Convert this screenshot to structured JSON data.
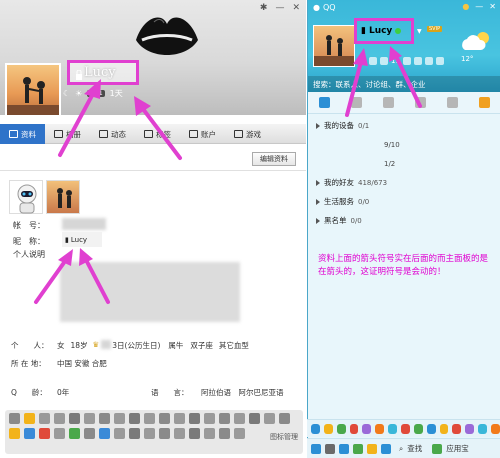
{
  "profile_window": {
    "name": "Lucy",
    "vip_badge": "VIP1",
    "days": "1天",
    "tabs": [
      {
        "label": "资料",
        "icon": "profile-card-icon"
      },
      {
        "label": "相册",
        "icon": "photo-album-icon"
      },
      {
        "label": "动态",
        "icon": "feed-icon"
      },
      {
        "label": "标签",
        "icon": "tag-icon"
      },
      {
        "label": "账户",
        "icon": "account-icon"
      },
      {
        "label": "游戏",
        "icon": "game-icon"
      }
    ],
    "edit_button": "编辑资料",
    "account_label": "帐　号：",
    "nickname_label": "昵　称：",
    "nickname_value": "Lucy",
    "bio_label": "个人说明",
    "person_label": "个　　人：",
    "gender": "女",
    "age": "18岁",
    "birthday": "3日(公历生日)",
    "zodiac": "属牛",
    "constellation": "双子座",
    "blood": "其它血型",
    "location_label": "所 在 地：",
    "location_value": "中国 安徽 合肥",
    "qage_label": "Q　　龄：",
    "qage_value": "0年",
    "language_label": "语　　言：",
    "language_value": "阿拉伯语　阿尔巴尼亚语",
    "icon_manage": "图标管理"
  },
  "qq_panel": {
    "title": "QQ",
    "name": "Lucy",
    "badge": "SVIP",
    "temperature": "12°",
    "count_small": "11",
    "search_placeholder": "搜索：联系人、讨论组、群、企业",
    "groups": [
      {
        "label": "我的设备",
        "count": "0/1"
      },
      {
        "label": "我的好友",
        "count": "418/673"
      },
      {
        "label": "生活服务",
        "count": "0/0"
      },
      {
        "label": "黑名单",
        "count": "0/0"
      }
    ],
    "sub_counts": [
      "9/10",
      "1/2"
    ],
    "annotation": "资料上面的箭头符号实在后面的而主面板的是在箭头的，这证明符号是会动的！",
    "find_label": "查找",
    "app_label": "应用宝"
  }
}
